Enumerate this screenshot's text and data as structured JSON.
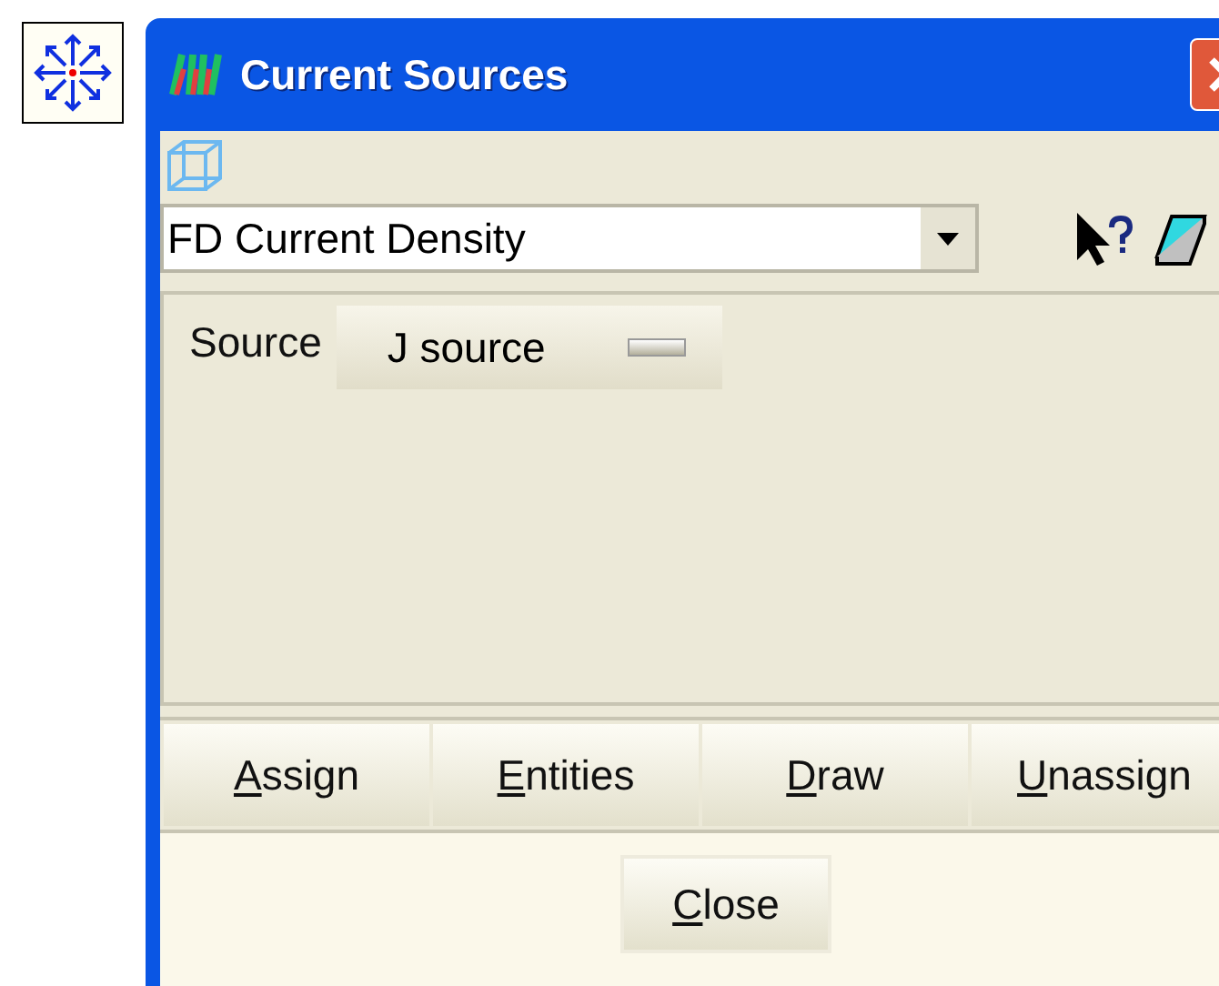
{
  "window": {
    "title": "Current Sources"
  },
  "combo": {
    "value": "FD Current Density"
  },
  "source": {
    "label": "Source",
    "value": "J source"
  },
  "actions": [
    {
      "key": "A",
      "rest": "ssign"
    },
    {
      "key": "E",
      "rest": "ntities"
    },
    {
      "key": "D",
      "rest": "raw"
    },
    {
      "key": "U",
      "rest": "nassign"
    }
  ],
  "close_button": {
    "key": "C",
    "rest": "lose"
  }
}
